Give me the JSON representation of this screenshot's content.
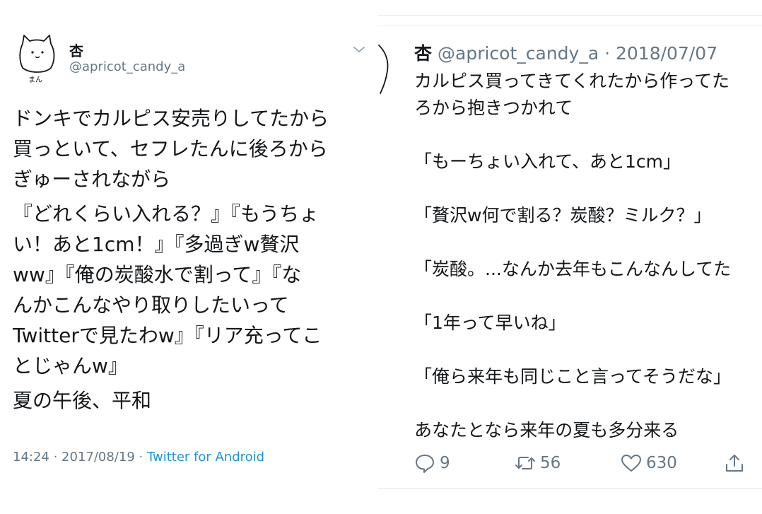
{
  "left": {
    "avatar_label": "まん",
    "name": "杏",
    "handle": "@apricot_candy_a",
    "paragraphs": [
      "ドンキでカルピス安売りしてたから\n買っといて、セフレたんに後ろから\nぎゅーされながら",
      "『どれくらい入れる？』『もうちょ\nい！あと1cm！』『多過ぎw贅沢\nww』『俺の炭酸水で割って』『な\nんかこんなやり取りしたいって\nTwitterで見たわw』『リア充ってこ\nとじゃんw』",
      "夏の午後、平和"
    ],
    "time": "14:24",
    "date": "2017/08/19",
    "separator": " · ",
    "source": "Twitter for Android"
  },
  "right": {
    "name": "杏",
    "handle": "@apricot_candy_a",
    "date_sep": " · ",
    "date": "2018/07/07",
    "lines": [
      "カルピス買ってきてくれたから作ってた",
      "ろから抱きつかれて",
      "",
      "「もーちょい入れて、あと1cm」",
      "",
      "「贅沢w何で割る？炭酸？ミルク？」",
      "",
      "「炭酸。...なんか去年もこんなんしてた",
      "",
      "「1年って早いね」",
      "",
      "「俺ら来年も同じこと言ってそうだな」",
      "",
      "あなたとなら来年の夏も多分来る"
    ],
    "actions": {
      "reply_count": "9",
      "retweet_count": "56",
      "like_count": "630"
    }
  },
  "colors": {
    "text": "#14171a",
    "secondary": "#657786",
    "link": "#1b95e0",
    "divider": "#e1e8ed"
  },
  "icons": {
    "reply": "reply-icon",
    "retweet": "retweet-icon",
    "like": "heart-icon",
    "share": "share-icon",
    "menu": "chevron-down-icon"
  }
}
